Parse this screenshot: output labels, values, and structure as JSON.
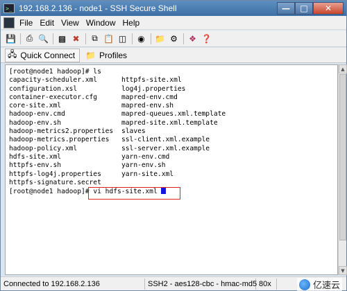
{
  "window": {
    "title": "192.168.2.136 - node1 - SSH Secure Shell",
    "icon": "ssh-terminal-icon",
    "controls": [
      "minimize",
      "maximize",
      "close"
    ]
  },
  "menubar": {
    "items": [
      "File",
      "Edit",
      "View",
      "Window",
      "Help"
    ]
  },
  "toolbar": {
    "icons": [
      "save-icon",
      "print-icon",
      "print-preview-icon",
      "new-terminal-icon",
      "disconnect-icon",
      "copy-icon",
      "paste-icon",
      "paste-special-icon",
      "find-icon",
      "file-transfer-icon",
      "settings-icon",
      "profile-icon",
      "help-icon"
    ]
  },
  "quickbar": {
    "quick_connect_label": "Quick Connect",
    "profiles_label": "Profiles"
  },
  "terminal": {
    "prompt": "[root@node1 hadoop]# ls",
    "listing": [
      [
        "capacity-scheduler.xml",
        "httpfs-site.xml"
      ],
      [
        "configuration.xsl",
        "log4j.properties"
      ],
      [
        "container-executor.cfg",
        "mapred-env.cmd"
      ],
      [
        "core-site.xml",
        "mapred-env.sh"
      ],
      [
        "hadoop-env.cmd",
        "mapred-queues.xml.template"
      ],
      [
        "hadoop-env.sh",
        "mapred-site.xml.template"
      ],
      [
        "hadoop-metrics2.properties",
        "slaves"
      ],
      [
        "hadoop-metrics.properties",
        "ssl-client.xml.example"
      ],
      [
        "hadoop-policy.xml",
        "ssl-server.xml.example"
      ],
      [
        "hdfs-site.xml",
        "yarn-env.cmd"
      ],
      [
        "httpfs-env.sh",
        "yarn-env.sh"
      ],
      [
        "httpfs-log4j.properties",
        "yarn-site.xml"
      ],
      [
        "httpfs-signature.secret",
        ""
      ]
    ],
    "current_prompt": "[root@node1 hadoop]#",
    "current_command": "vi hdfs-site.xml"
  },
  "statusbar": {
    "connection": "Connected to 192.168.2.136",
    "cipher": "SSH2 - aes128-cbc - hmac-md5",
    "size": "80x"
  },
  "watermark": {
    "text": "亿速云"
  },
  "colors": {
    "titlebar": "#4a7db3",
    "cursor": "#1418d8",
    "highlight": "#e02020"
  }
}
